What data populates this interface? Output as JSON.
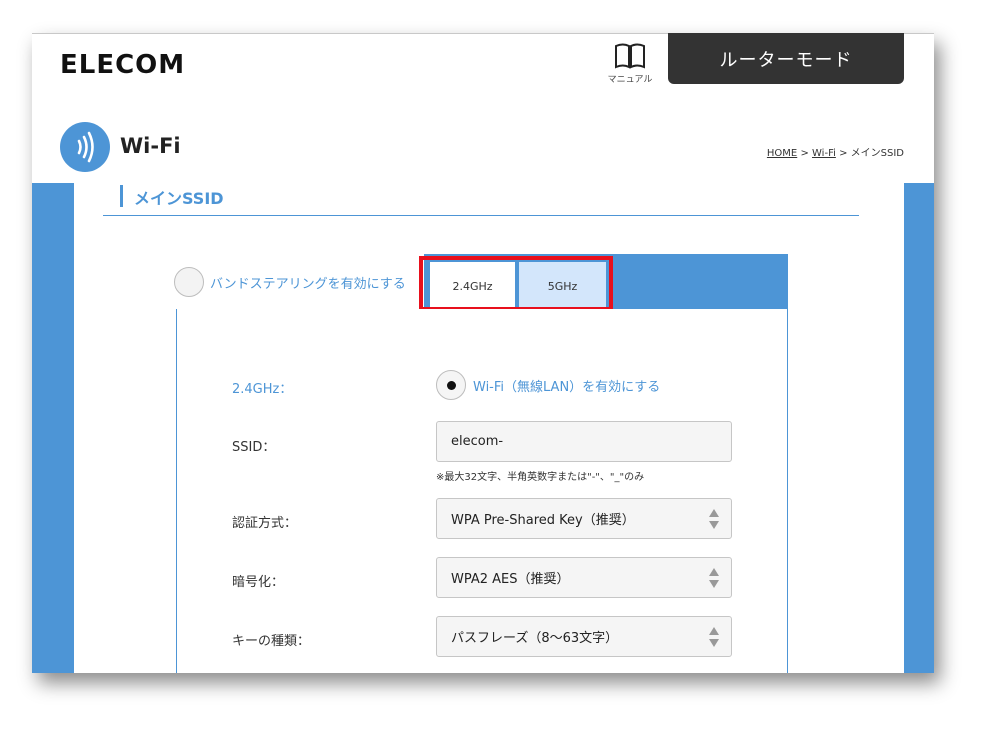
{
  "header": {
    "logo": "ELECOM",
    "manual_label": "マニュアル",
    "mode_button": "ルーターモード"
  },
  "page": {
    "title": "Wi-Fi",
    "breadcrumb": [
      "HOME",
      ">",
      "Wi-Fi",
      ">",
      "メインSSID"
    ]
  },
  "section": {
    "title": "メインSSID"
  },
  "band_steering": {
    "label": "バンドステアリングを有効にする",
    "checked": false
  },
  "tabs": [
    {
      "label": "2.4GHz",
      "active": true
    },
    {
      "label": "5GHz",
      "active": false
    }
  ],
  "form": {
    "band_label": "2.4GHz：",
    "wifi_enable_label": "Wi-Fi（無線LAN）を有効にする",
    "wifi_enabled": true,
    "ssid_label": "SSID：",
    "ssid_value": "elecom-",
    "ssid_note": "※最大32文字、半角英数字または\"-\"、\"_\"のみ",
    "auth_label": "認証方式：",
    "auth_value": "WPA Pre-Shared Key（推奨）",
    "encryption_label": "暗号化：",
    "encryption_value": "WPA2 AES（推奨）",
    "key_type_label": "キーの種類：",
    "key_type_value": "パスフレーズ（8〜63文字）"
  },
  "colors": {
    "accent": "#4d95d6",
    "highlight": "#e8101d",
    "mode_button": "#333333",
    "tab_inactive": "#d3e6fb"
  },
  "icons": {
    "manual": "book-icon",
    "wifi": "wifi-signal-icon",
    "select": "updown-arrows-icon"
  }
}
